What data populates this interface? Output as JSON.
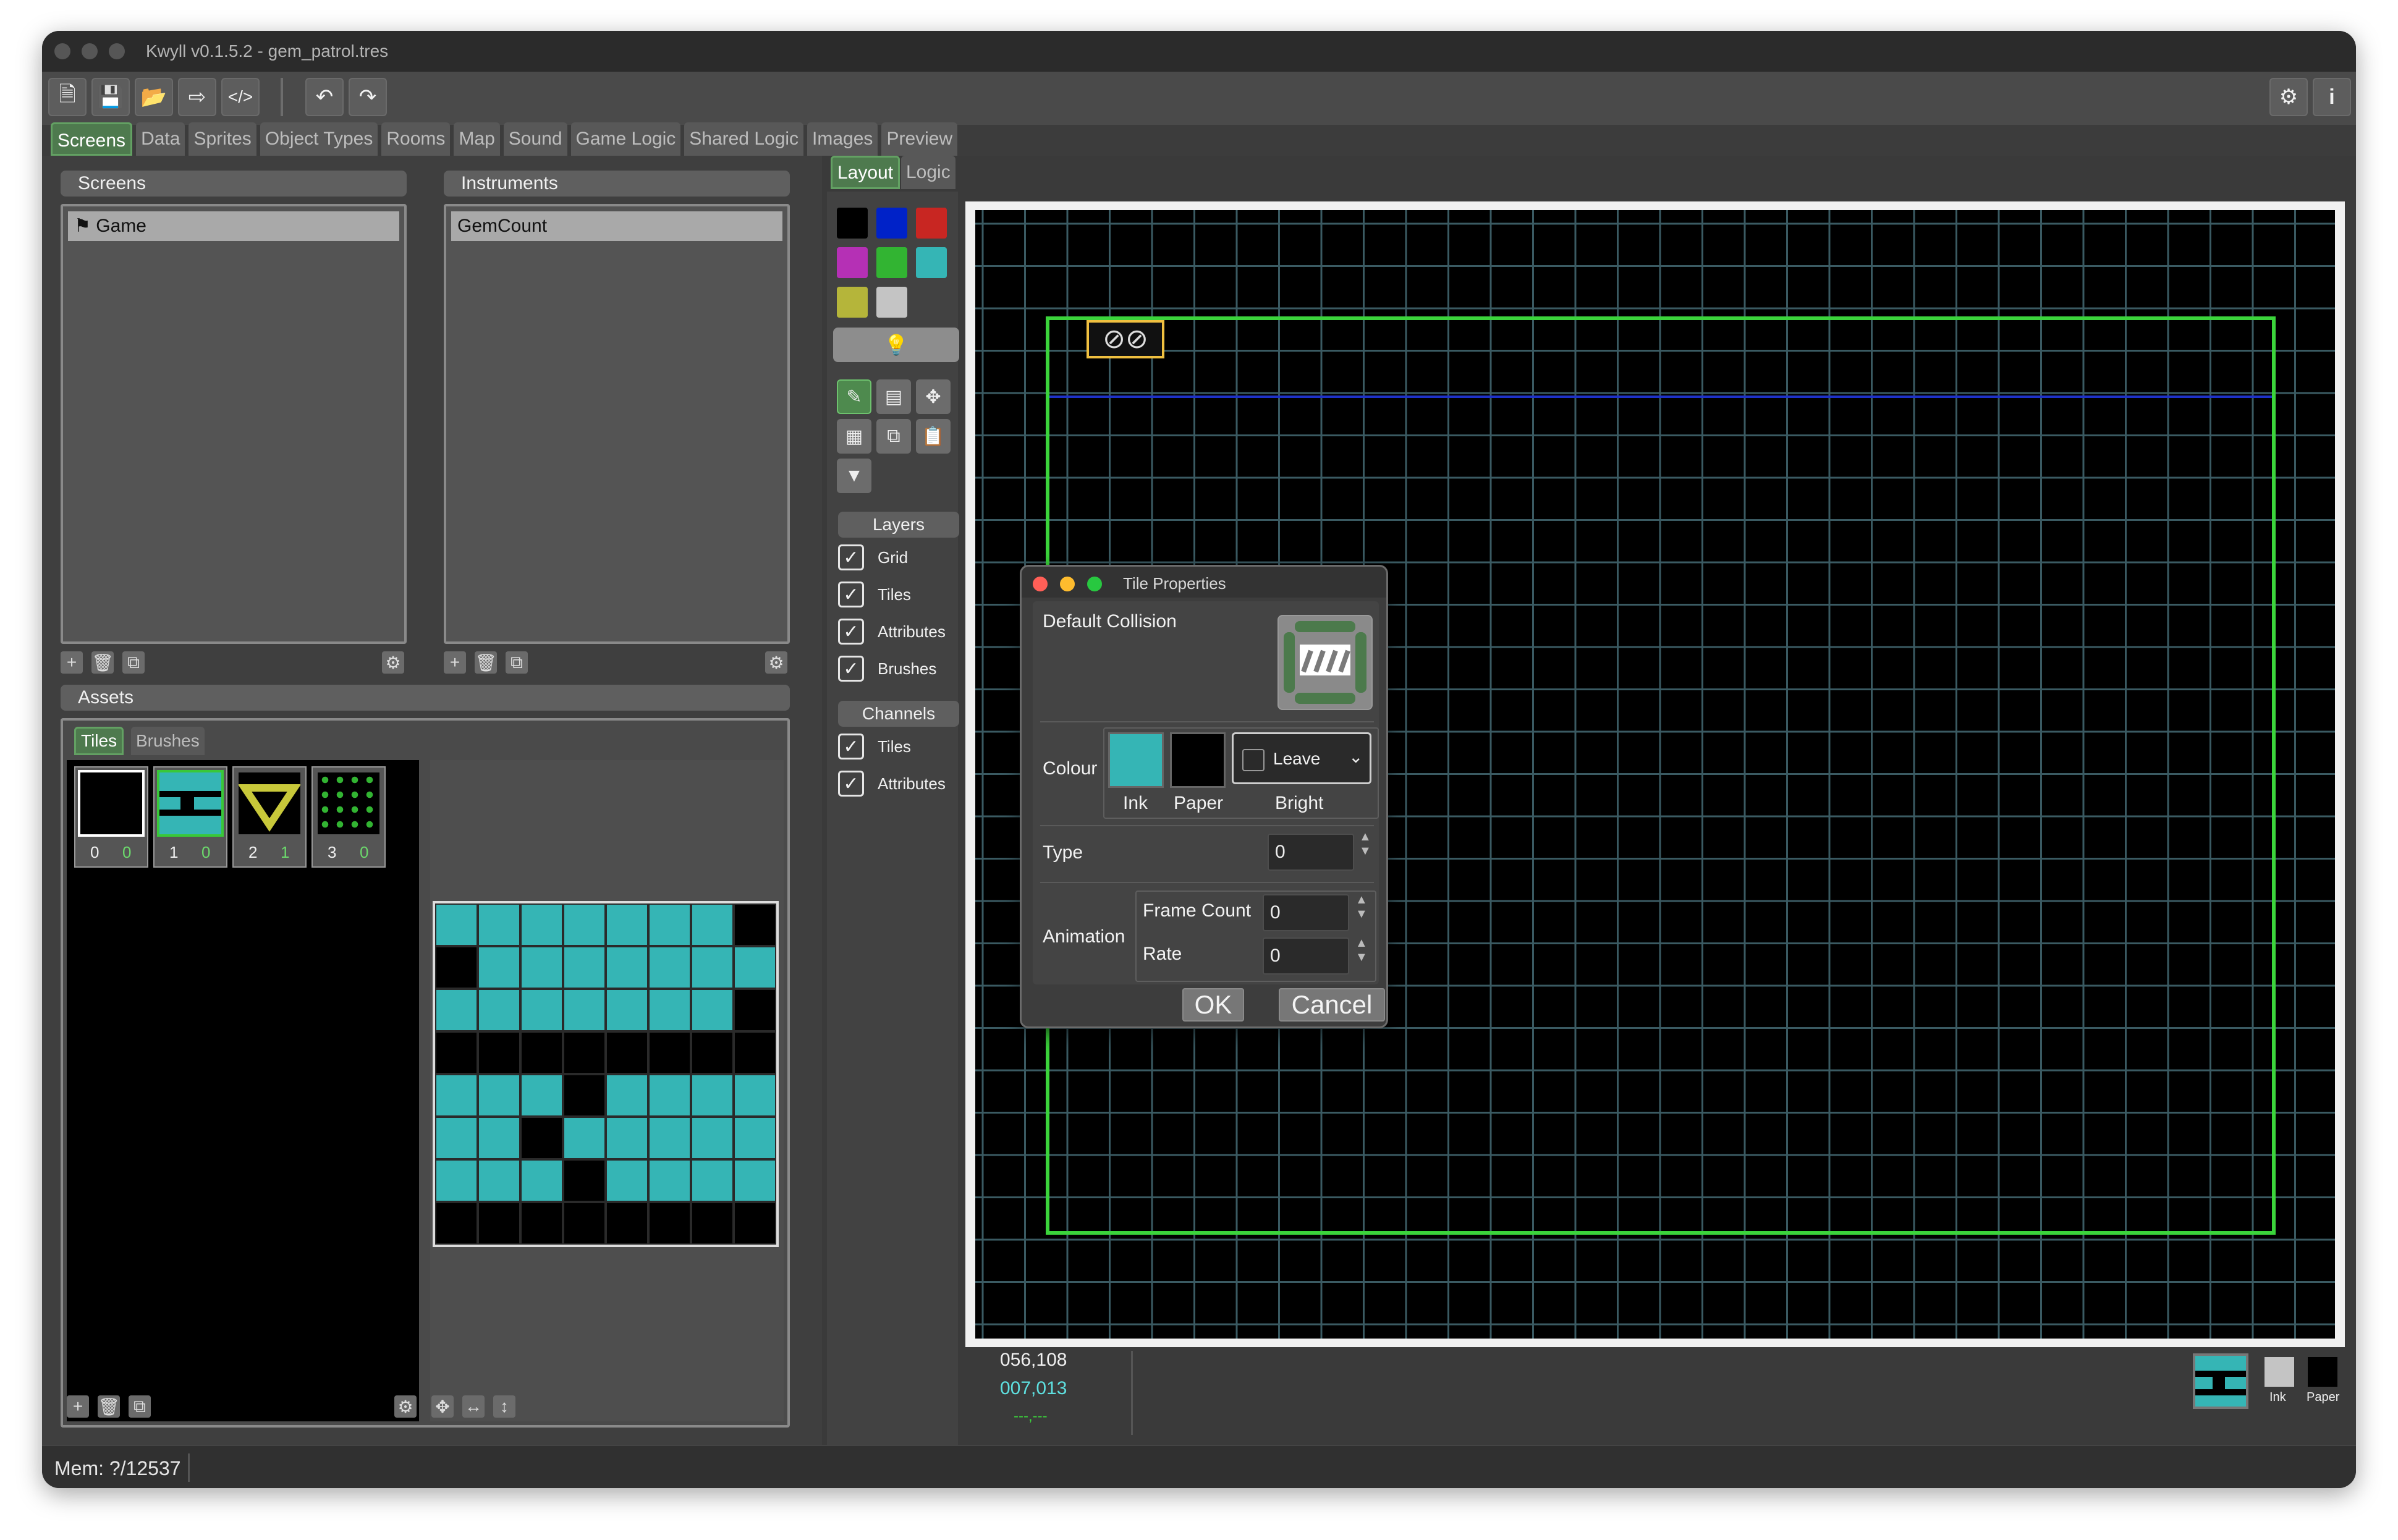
{
  "window": {
    "title": "Kwyll v0.1.5.2 - gem_patrol.tres"
  },
  "toolbar": {
    "icons": [
      "new-file-icon",
      "save-icon",
      "open-folder-icon",
      "export-icon",
      "code-icon",
      "undo-icon",
      "redo-icon",
      "settings-icon",
      "info-icon"
    ]
  },
  "tabs": [
    "Screens",
    "Data",
    "Sprites",
    "Object Types",
    "Rooms",
    "Map",
    "Sound",
    "Game Logic",
    "Shared Logic",
    "Images",
    "Preview"
  ],
  "screens_panel": {
    "title": "Screens",
    "items": [
      "Game"
    ]
  },
  "instruments_panel": {
    "title": "Instruments",
    "items": [
      "GemCount"
    ]
  },
  "assets_panel": {
    "title": "Assets",
    "tabs": [
      "Tiles",
      "Brushes"
    ],
    "tiles": [
      {
        "index": "0",
        "attr": "0"
      },
      {
        "index": "1",
        "attr": "0"
      },
      {
        "index": "2",
        "attr": "1"
      },
      {
        "index": "3",
        "attr": "0"
      }
    ]
  },
  "editor_tabs": [
    "Layout",
    "Logic"
  ],
  "palette_colors": [
    "#000000",
    "#0022c8",
    "#c82622",
    "#b530b5",
    "#32b432",
    "#35b5b5",
    "#b5b53a",
    "#c4c4c4"
  ],
  "layers": {
    "title": "Layers",
    "items": [
      "Grid",
      "Tiles",
      "Attributes",
      "Brushes"
    ]
  },
  "channels": {
    "title": "Channels",
    "items": [
      "Tiles",
      "Attributes"
    ]
  },
  "canvas_info": {
    "coords1": "056,108",
    "coords2": "007,013",
    "coords3": "---,---"
  },
  "ink_paper": {
    "ink_label": "Ink",
    "paper_label": "Paper"
  },
  "dialog": {
    "title": "Tile Properties",
    "default_collision": "Default Collision",
    "colour": "Colour",
    "ink": "Ink",
    "paper": "Paper",
    "bright_label": "Bright",
    "bright_value": "Leave",
    "type_label": "Type",
    "type_value": "0",
    "animation": "Animation",
    "frame_count_label": "Frame Count",
    "frame_count_value": "0",
    "rate_label": "Rate",
    "rate_value": "0",
    "ok": "OK",
    "cancel": "Cancel"
  },
  "status": {
    "mem": "Mem: ?/12537"
  }
}
